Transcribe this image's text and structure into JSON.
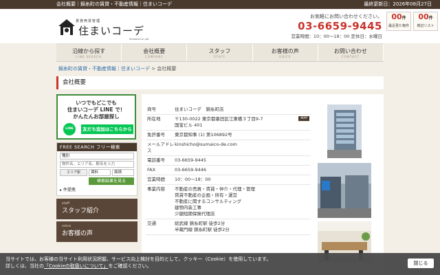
{
  "topbar": {
    "left_text": "会社概要｜錦糸町の賃貸・不動産情報｜住まいコーデ",
    "update": "最終更新日：2026年08月27日"
  },
  "logo": {
    "sub": "賃貸売買管理",
    "name": "住まいコーデ",
    "tag": "Sumaico.Co.,Ltd"
  },
  "contact": {
    "question": "お気軽にお問い合わせください。",
    "tel": "03-6659-9445",
    "hours": "営業時間：10：00〜18：00 定休日：水曜日"
  },
  "counters": [
    {
      "num": "00",
      "unit": "件",
      "label": "最近見た物件"
    },
    {
      "num": "00",
      "unit": "件",
      "label": "検討リスト"
    }
  ],
  "gnav": [
    {
      "ja": "沿線から探す",
      "en": "LINE SEARCH"
    },
    {
      "ja": "会社概要",
      "en": "COMPANY"
    },
    {
      "ja": "スタッフ",
      "en": "STAFF"
    },
    {
      "ja": "お客様の声",
      "en": "VOICE"
    },
    {
      "ja": "お問い合わせ",
      "en": "CONTACT"
    }
  ],
  "breadcrumb": {
    "home": "錦糸町の賃貸・不動産情報｜住まいコーデ",
    "sep": ">",
    "current": "会社概要"
  },
  "page_title": "会社概要",
  "line_banner": {
    "l1": "いつでもどこでも",
    "l2": "住まいコーデ LINE で！",
    "l3": "かんたんお部屋探し",
    "line": "LINE",
    "add": "友だち追加はこちらから"
  },
  "free_search": {
    "head": "FREE SEARCH フリー検索",
    "select1": "種別",
    "keyword_placeholder": "物件名、エリア名、駅名を入力",
    "station": "エリア駅",
    "rent": "賃料",
    "area": "面積",
    "search_btn": "検索結果を見る",
    "popular": "▸ 件提携"
  },
  "side_boxes": [
    {
      "en": "staff",
      "ja": "スタッフ紹介"
    },
    {
      "en": "voice",
      "ja": "お客様の声"
    }
  ],
  "company": [
    {
      "label": "商号",
      "value": "住まいコーデ　錦糸町店"
    },
    {
      "label": "所在地",
      "value": "〒130-0022 東京都墨田区江東橋３丁目9-7\n国宝ビル 401",
      "map": "MAP"
    },
    {
      "label": "免許番号",
      "value": "東京都知事 (1) 第106892号"
    },
    {
      "label": "メールアドレス",
      "value": "kinshicho@sumaico-de.com",
      "mail": true
    },
    {
      "label": "電話番号",
      "value": "03-6659-9445"
    },
    {
      "label": "FAX",
      "value": "03-6659-9446"
    },
    {
      "label": "営業時間",
      "value": "10：00〜18：00"
    },
    {
      "label": "事業内容",
      "value": "不動産の売買・賃貸・仲介・代理・管理\n賃貸不動産の企画・所有・運営\n不動産に関するコンサルティング\n建物内装工事\n少額短期保険代理店"
    },
    {
      "label": "交通",
      "value": "総武線 錦糸町駅 徒歩2分\n半蔵門線 錦糸町駅 徒歩2分"
    }
  ],
  "cookie": {
    "line1": "当サイトでは、お客様の当サイト利用状況把握、サービス向上検討を目的として、クッキー（Cookie）を使用しています。",
    "line2a": "詳しくは、当社の",
    "link": "「Cookieの取扱いについて」",
    "line2b": "をご確認ください。",
    "close": "閉じる"
  },
  "colors": {
    "accent": "#c8332c",
    "brand_dark": "#4a3a2e",
    "line_green": "#06c755"
  }
}
